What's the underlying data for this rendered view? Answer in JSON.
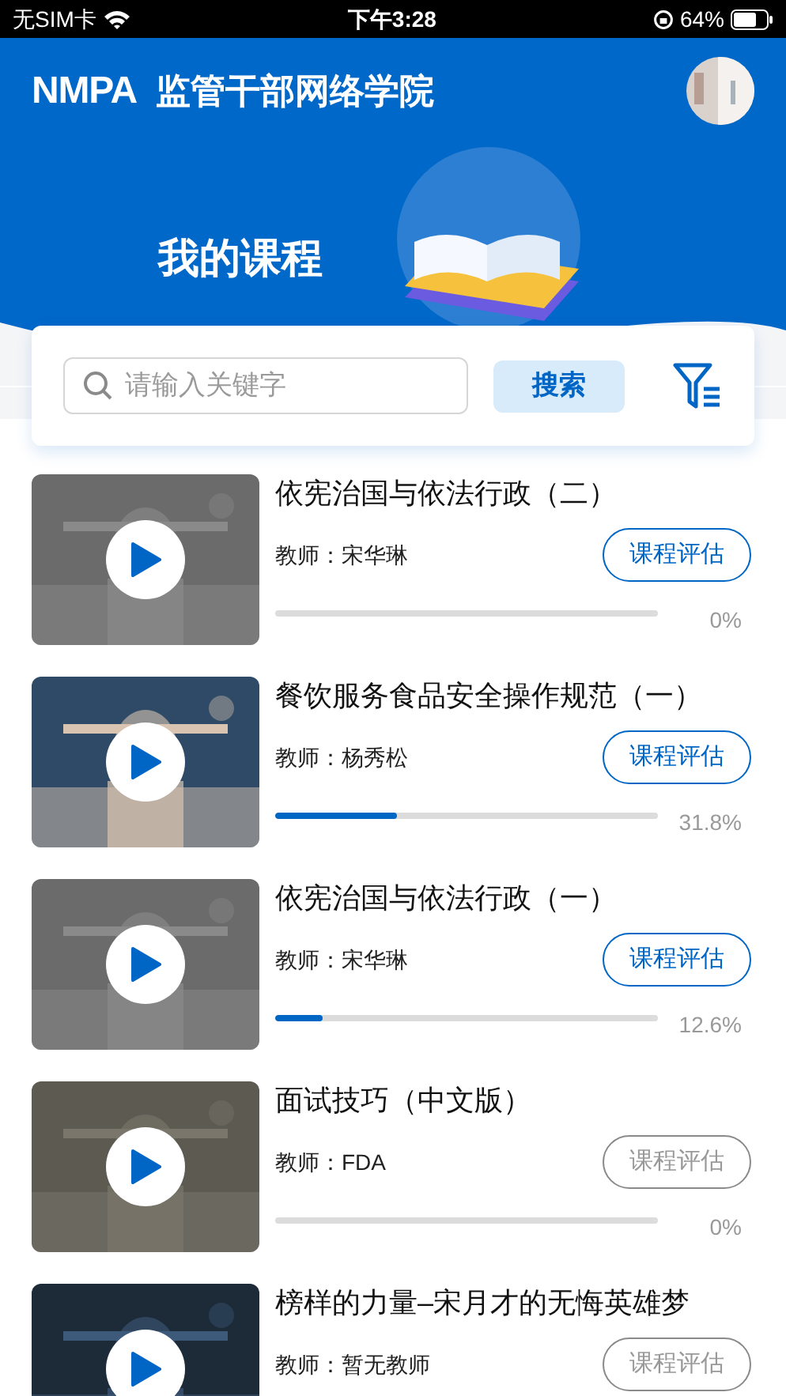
{
  "status_bar": {
    "carrier": "无SIM卡",
    "time": "下午3:28",
    "battery": "64%"
  },
  "header": {
    "logo": "NMPA",
    "title": "监管干部网络学院"
  },
  "banner": {
    "title": "我的课程"
  },
  "search": {
    "placeholder": "请输入关键字",
    "button": "搜索"
  },
  "courses": [
    {
      "title": "依宪治国与依法行政（二）",
      "teacher": "教师：宋华琳",
      "evaluate": "课程评估",
      "disabled": false,
      "level": 0,
      "progress": "0%"
    },
    {
      "title": "餐饮服务食品安全操作规范（一）",
      "teacher": "教师：杨秀松",
      "evaluate": "课程评估",
      "disabled": false,
      "level": 0.318,
      "progress": "31.8%"
    },
    {
      "title": "依宪治国与依法行政（一）",
      "teacher": "教师：宋华琳",
      "evaluate": "课程评估",
      "disabled": false,
      "level": 0.126,
      "progress": "12.6%"
    },
    {
      "title": "面试技巧（中文版）",
      "teacher": "教师：FDA",
      "evaluate": "课程评估",
      "disabled": true,
      "level": 0,
      "progress": "0%"
    },
    {
      "title": "榜样的力量–宋月才的无悔英雄梦",
      "teacher": "教师：暂无教师",
      "evaluate": "课程评估",
      "disabled": true
    }
  ]
}
